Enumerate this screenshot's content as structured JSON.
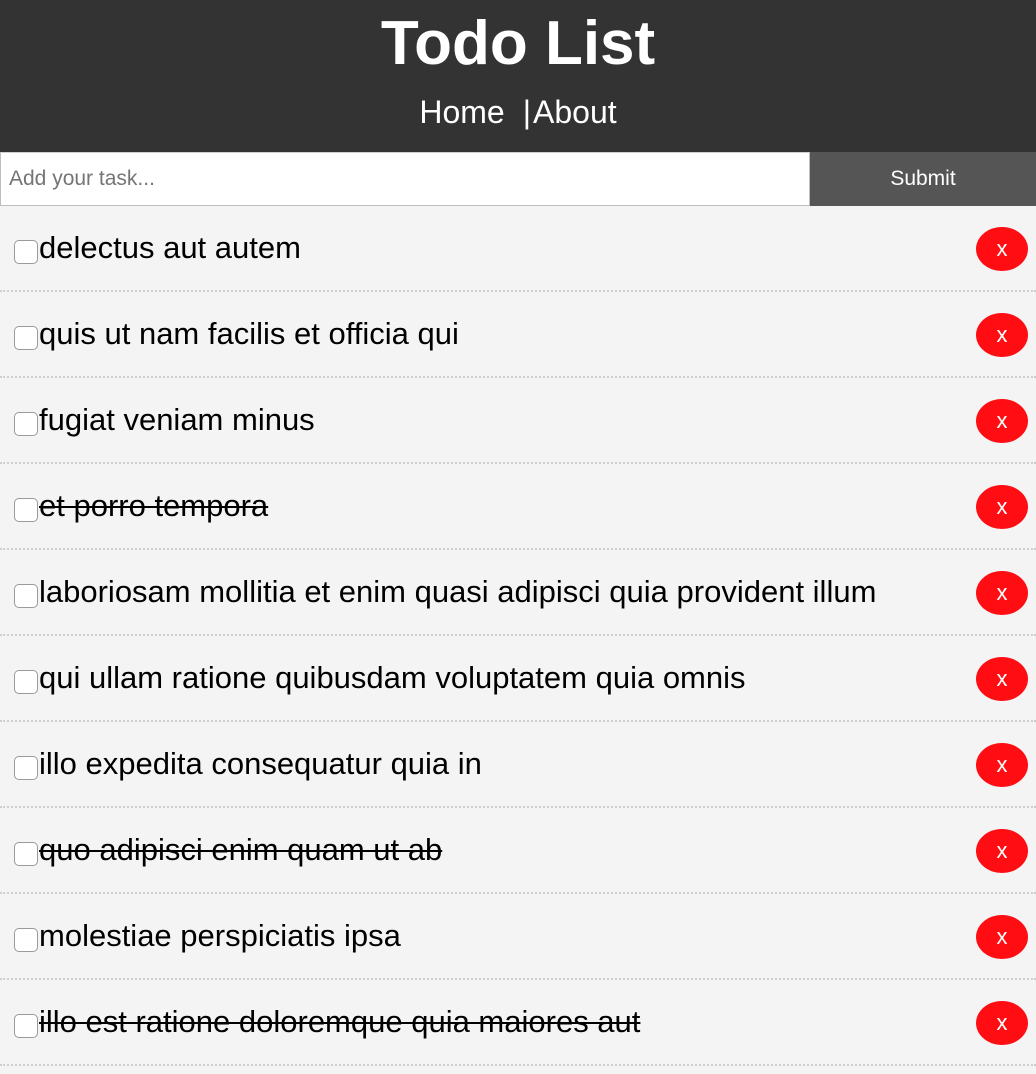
{
  "header": {
    "title": "Todo List",
    "nav": {
      "home": "Home",
      "separator": "|",
      "about": "About"
    }
  },
  "form": {
    "placeholder": "Add your task...",
    "value": "",
    "submit_label": "Submit"
  },
  "todos": [
    {
      "text": "delectus aut autem",
      "completed": false,
      "delete_label": "x"
    },
    {
      "text": "quis ut nam facilis et officia qui",
      "completed": false,
      "delete_label": "x"
    },
    {
      "text": "fugiat veniam minus",
      "completed": false,
      "delete_label": "x"
    },
    {
      "text": "et porro tempora",
      "completed": true,
      "delete_label": "x"
    },
    {
      "text": "laboriosam mollitia et enim quasi adipisci quia provident illum",
      "completed": false,
      "delete_label": "x"
    },
    {
      "text": "qui ullam ratione quibusdam voluptatem quia omnis",
      "completed": false,
      "delete_label": "x"
    },
    {
      "text": "illo expedita consequatur quia in",
      "completed": false,
      "delete_label": "x"
    },
    {
      "text": "quo adipisci enim quam ut ab",
      "completed": true,
      "delete_label": "x"
    },
    {
      "text": "molestiae perspiciatis ipsa",
      "completed": false,
      "delete_label": "x"
    },
    {
      "text": "illo est ratione doloremque quia maiores aut",
      "completed": true,
      "delete_label": "x"
    }
  ],
  "colors": {
    "header_bg": "#333333",
    "submit_bg": "#555555",
    "delete_bg": "#ff0d12",
    "list_bg": "#f4f4f4"
  }
}
